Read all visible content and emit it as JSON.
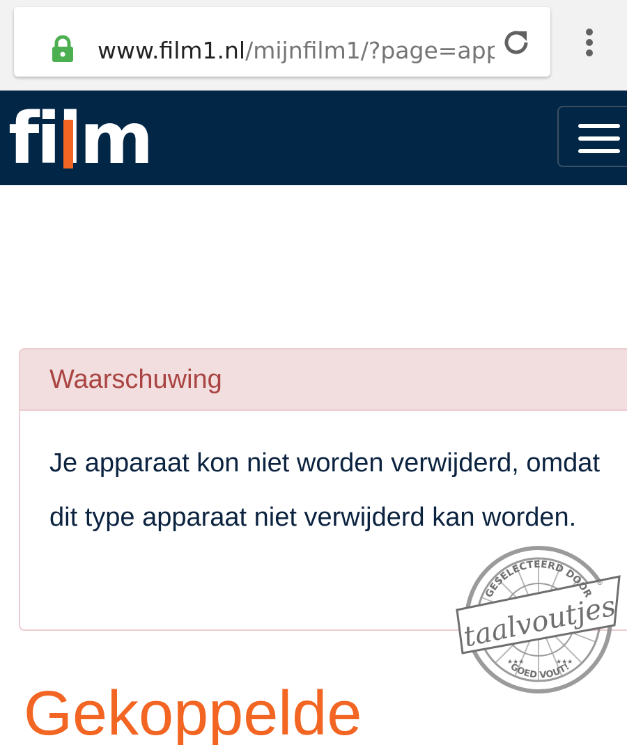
{
  "browser": {
    "url_host": "www.film1.nl",
    "url_path": "/mijnfilm1/?page=app",
    "icons": {
      "lock": "lock-icon",
      "reload": "reload-icon",
      "menu": "more-vert-icon"
    },
    "lock_color": "#4caf50"
  },
  "header": {
    "logo_text": "film",
    "logo_accent_color": "#f26522",
    "background_color": "#022646",
    "nav_icon": "hamburger-icon"
  },
  "warning": {
    "title": "Waarschuwing",
    "message": "Je apparaat kon niet worden verwijderd, omdat dit type apparaat niet verwijderd kan worden."
  },
  "stamp": {
    "top_text": "GESELECTEERD DOOR",
    "brand": "taalvoutjes",
    "bottom_text": "GOED VOUT!",
    "registered": "®",
    "stars": "★★★"
  },
  "page_heading_partial": "Gekoppelde"
}
